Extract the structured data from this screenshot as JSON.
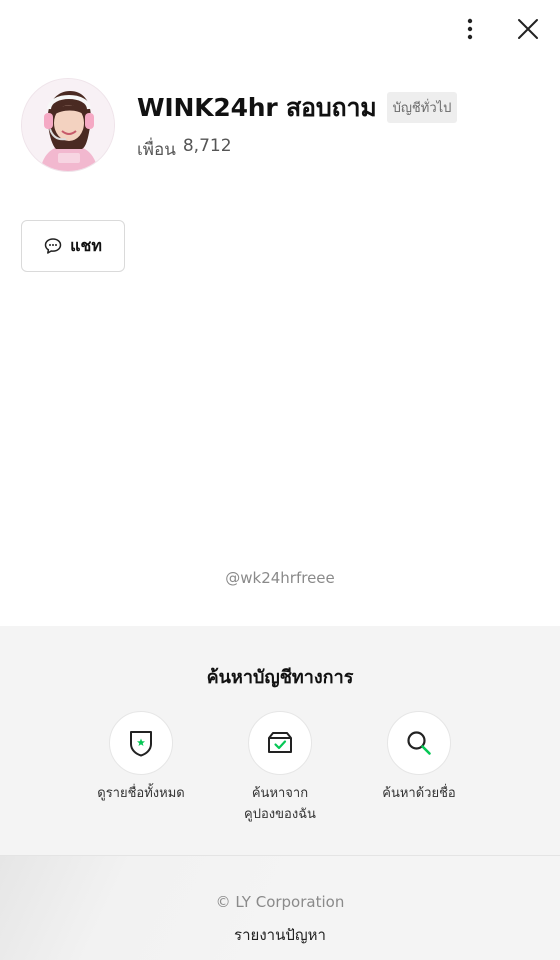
{
  "profile": {
    "name": "WINK24hr สอบถาม",
    "badge": "บัญชีทั่วไป",
    "friends_label": "เพื่อน",
    "friends_count": "8,712"
  },
  "actions": {
    "chat_label": "แชท"
  },
  "line_id": "@wk24hrfreee",
  "official_search": {
    "title": "ค้นหาบัญชีทางการ",
    "options": [
      {
        "label": "ดูรายชื่อทั้งหมด",
        "icon": "shield-star-icon"
      },
      {
        "label_line1": "ค้นหาจาก",
        "label_line2": "คูปองของฉัน",
        "icon": "coupon-box-icon"
      },
      {
        "label": "ค้นหาด้วยชื่อ",
        "icon": "search-icon"
      }
    ]
  },
  "footer": {
    "copyright": "© LY Corporation",
    "report": "รายงานปัญหา"
  },
  "colors": {
    "accent_green": "#06c755",
    "panel_bg": "#f4f4f4"
  }
}
